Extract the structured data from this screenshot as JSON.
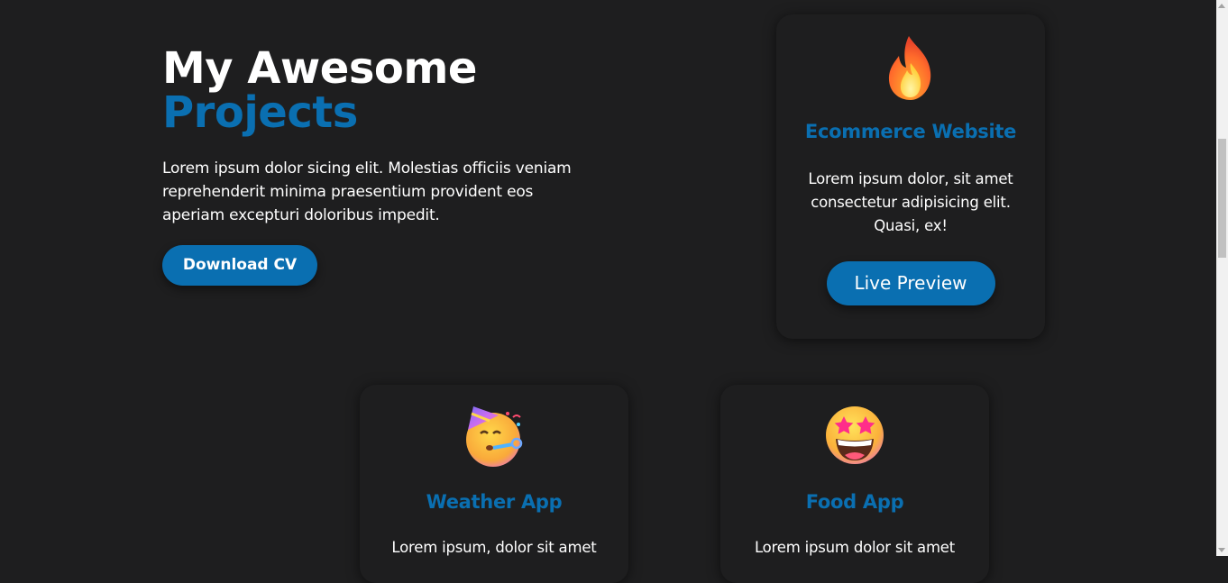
{
  "hero": {
    "title_line1": "My Awesome",
    "title_line2": "Projects",
    "description": "Lorem ipsum dolor sicing elit. Molestias officiis veniam reprehenderit minima praesentium provident eos aperiam excepturi doloribus impedit.",
    "cv_button": "Download CV"
  },
  "projects": [
    {
      "icon": "fire-emoji-icon",
      "title": "Ecommerce Website",
      "description": "Lorem ipsum dolor, sit amet consectetur adipisicing elit. Quasi, ex!",
      "button": "Live Preview"
    },
    {
      "icon": "partying-face-emoji-icon",
      "title": "Weather App",
      "description": "Lorem ipsum, dolor sit amet"
    },
    {
      "icon": "star-struck-emoji-icon",
      "title": "Food App",
      "description": "Lorem ipsum dolor sit amet"
    }
  ],
  "colors": {
    "background": "#1e1e1f",
    "accent": "#0a6fb1",
    "text": "#ffffff"
  }
}
